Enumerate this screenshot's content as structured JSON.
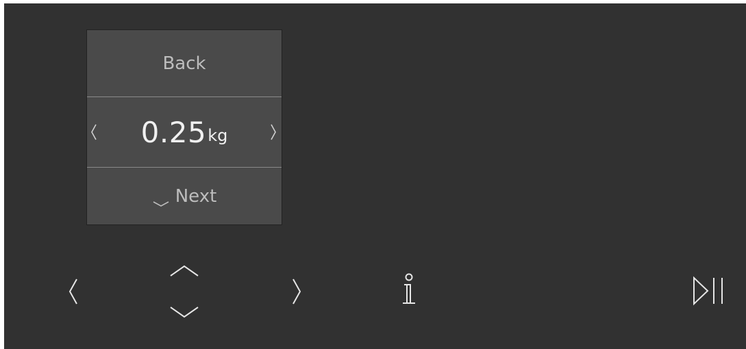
{
  "panel": {
    "back_label": "Back",
    "value": "0.25",
    "unit": "kg",
    "next_label": "Next"
  },
  "controls": {
    "left": "chevron-left-icon",
    "up": "chevron-up-icon",
    "down": "chevron-down-icon",
    "right": "chevron-right-icon",
    "info": "info-icon",
    "play_pause": "play-pause-icon"
  },
  "colors": {
    "background": "#313131",
    "panel": "#4a4a4a",
    "text": "#bdbdbd",
    "value_text": "#f0f0f0",
    "icon": "#e6e6e6"
  }
}
